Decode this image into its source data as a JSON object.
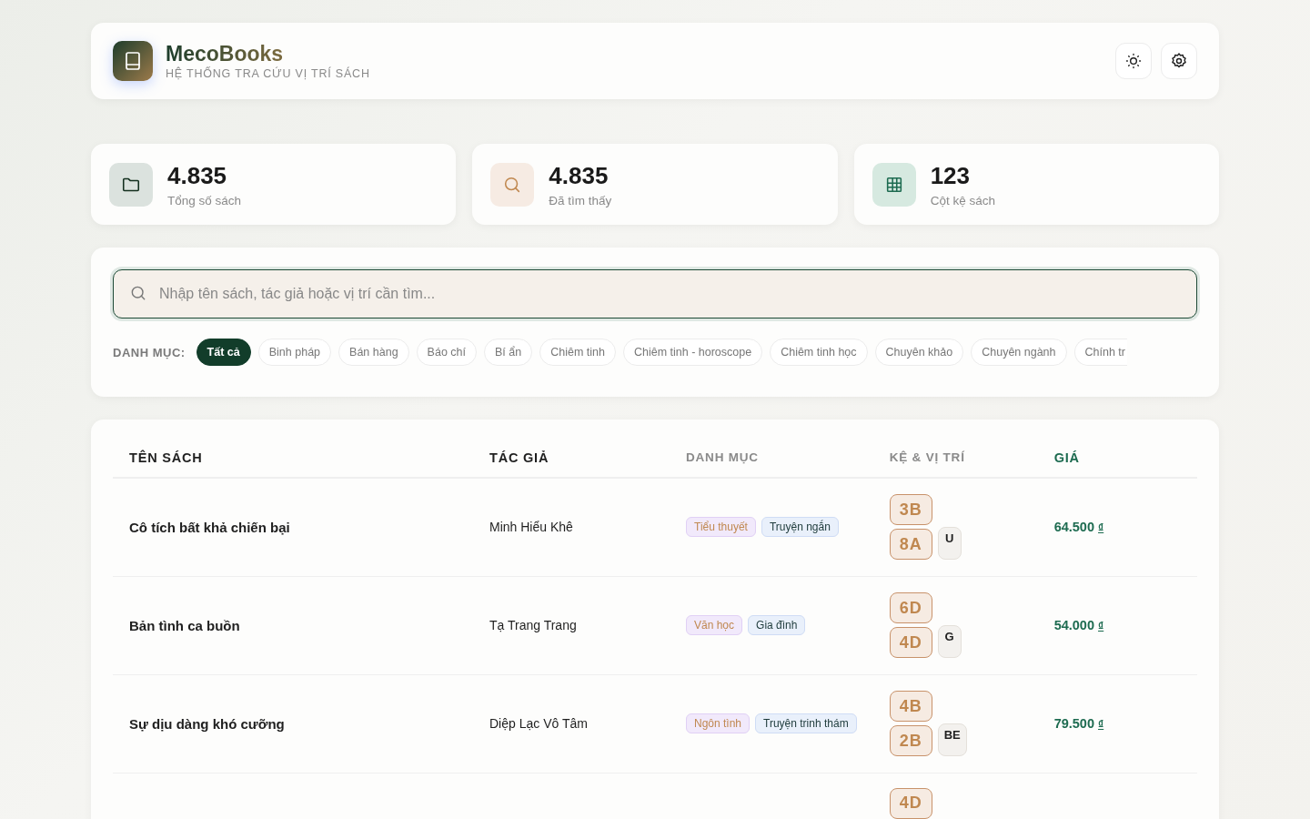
{
  "brand": {
    "name": "MecoBooks",
    "tagline": "HỆ THỐNG TRA CỨU VỊ TRÍ SÁCH"
  },
  "stats": [
    {
      "kind": "folder",
      "value": "4.835",
      "label": "Tổng số sách"
    },
    {
      "kind": "search",
      "value": "4.835",
      "label": "Đã tìm thấy"
    },
    {
      "kind": "grid",
      "value": "123",
      "label": "Cột kệ sách"
    }
  ],
  "search": {
    "placeholder": "Nhập tên sách, tác giả hoặc vị trí cần tìm..."
  },
  "filter_label": "DANH MỤC:",
  "categories": [
    {
      "label": "Tất cả",
      "selected": true
    },
    {
      "label": "Binh pháp",
      "selected": false
    },
    {
      "label": "Bán hàng",
      "selected": false
    },
    {
      "label": "Báo chí",
      "selected": false
    },
    {
      "label": "Bí ẩn",
      "selected": false
    },
    {
      "label": "Chiêm tinh",
      "selected": false
    },
    {
      "label": "Chiêm tinh - horoscope",
      "selected": false
    },
    {
      "label": "Chiêm tinh học",
      "selected": false
    },
    {
      "label": "Chuyên khảo",
      "selected": false
    },
    {
      "label": "Chuyên ngành",
      "selected": false
    },
    {
      "label": "Chính tr",
      "selected": false
    }
  ],
  "table": {
    "columns": [
      "TÊN SÁCH",
      "TÁC GIẢ",
      "DANH MỤC",
      "KỆ & VỊ TRÍ",
      "GIÁ"
    ],
    "rows": [
      {
        "title": "Cô tích bất khả chiến bại",
        "author": "Minh Hiểu Khê",
        "tags": [
          {
            "label": "Tiểu thuyết",
            "kind": "primary"
          },
          {
            "label": "Truyện ngắn",
            "kind": "secondary"
          }
        ],
        "shelves": [
          "3B",
          "8A"
        ],
        "slot": "U",
        "price": "64.500",
        "currency": "₫"
      },
      {
        "title": "Bản tình ca buồn",
        "author": "Tạ Trang Trang",
        "tags": [
          {
            "label": "Văn học",
            "kind": "primary"
          },
          {
            "label": "Gia đình",
            "kind": "secondary"
          }
        ],
        "shelves": [
          "6D",
          "4D"
        ],
        "slot": "G",
        "price": "54.000",
        "currency": "₫"
      },
      {
        "title": "Sự dịu dàng khó cưỡng",
        "author": "Diệp Lạc Vô Tâm",
        "tags": [
          {
            "label": "Ngôn tình",
            "kind": "primary"
          },
          {
            "label": "Truyện trinh thám",
            "kind": "secondary"
          }
        ],
        "shelves": [
          "4B",
          "2B"
        ],
        "slot": "BE",
        "price": "79.500",
        "currency": "₫"
      },
      {
        "shelves": [
          "4D"
        ]
      }
    ]
  }
}
